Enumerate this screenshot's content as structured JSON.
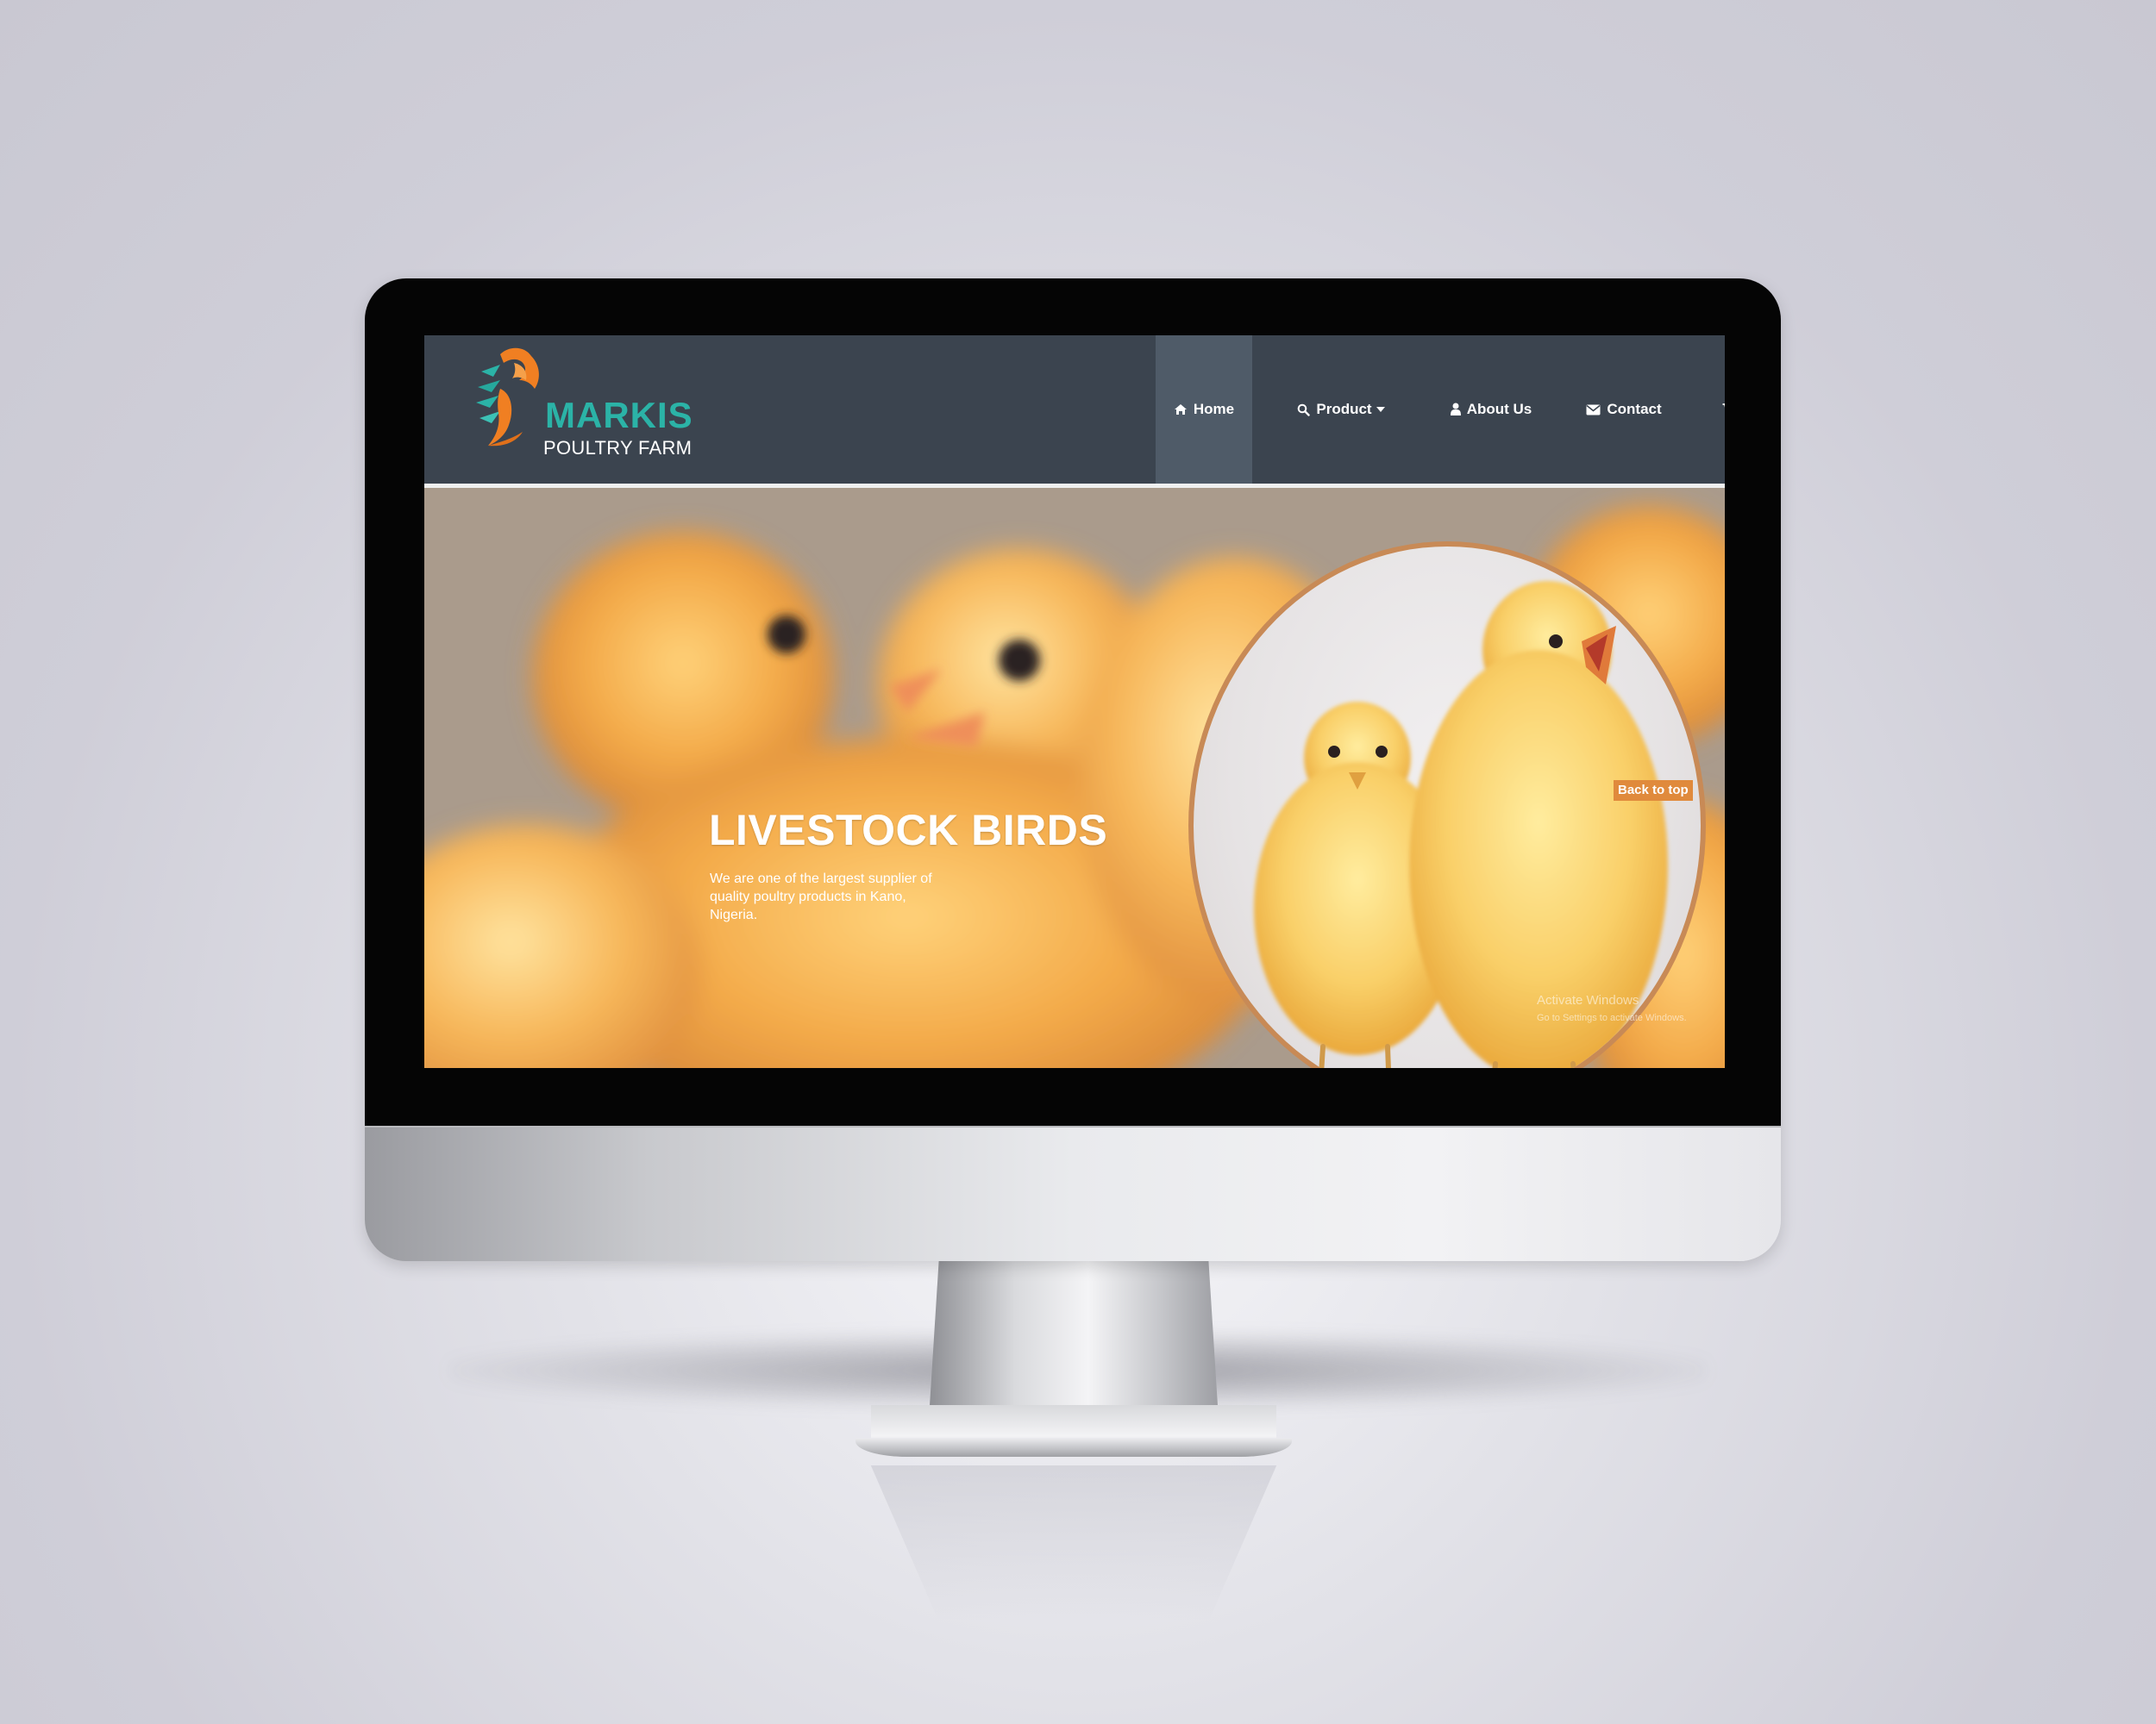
{
  "brand": {
    "name": "MARKIS",
    "subtitle": "POULTRY FARM",
    "colors": {
      "teal": "#2bb3a7",
      "orange": "#f07f22"
    }
  },
  "nav": {
    "items": [
      {
        "label": "Home",
        "icon": "home-icon",
        "active": true
      },
      {
        "label": "Product",
        "icon": "search-icon",
        "dropdown": true
      },
      {
        "label": "About Us",
        "icon": "user-icon"
      },
      {
        "label": "Contact",
        "icon": "envelope-icon"
      },
      {
        "label": "",
        "icon": "cart-icon"
      }
    ],
    "colors": {
      "bar": "#3b444f",
      "active": "#4f5b68"
    }
  },
  "hero": {
    "title": "LIVESTOCK BIRDS",
    "description": "We are one of the largest supplier of quality poultry products in Kano, Nigeria.",
    "back_to_top": "Back to top",
    "colors": {
      "accent": "#e08a3c",
      "frame": "#c88a56"
    }
  },
  "watermark": {
    "line1": "Activate Windows",
    "line2": "Go to Settings to activate Windows."
  }
}
